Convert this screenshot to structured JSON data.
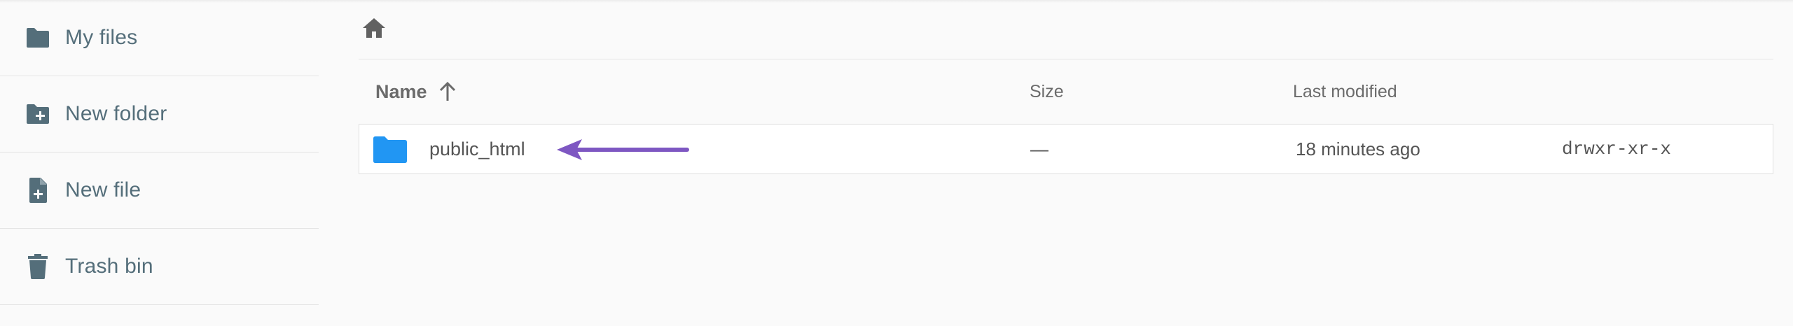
{
  "sidebar": {
    "items": [
      {
        "label": "My files",
        "icon": "folder-icon"
      },
      {
        "label": "New folder",
        "icon": "folder-plus-icon"
      },
      {
        "label": "New file",
        "icon": "file-plus-icon"
      },
      {
        "label": "Trash bin",
        "icon": "trash-icon"
      }
    ]
  },
  "breadcrumb": {
    "home_icon": "home-icon"
  },
  "table": {
    "columns": {
      "name": "Name",
      "size": "Size",
      "modified": "Last modified"
    },
    "sort_icon": "arrow-up-icon",
    "rows": [
      {
        "name": "public_html",
        "size": "—",
        "modified": "18 minutes ago",
        "permissions": "drwxr-xr-x",
        "icon": "folder-icon"
      }
    ]
  },
  "colors": {
    "sidebar_icon": "#546e7a",
    "folder_blue": "#2196f3",
    "arrow_purple": "#7e57c2",
    "home_icon": "#616161"
  }
}
